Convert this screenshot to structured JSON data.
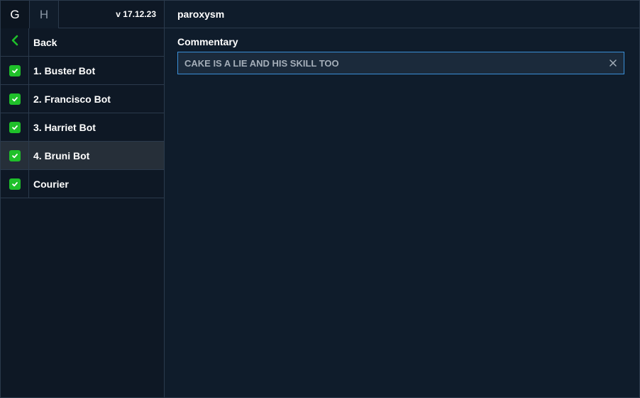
{
  "sidebar": {
    "tabs": [
      {
        "label": "G",
        "active": true
      },
      {
        "label": "H",
        "active": false
      }
    ],
    "version": "v 17.12.23",
    "back_label": "Back",
    "items": [
      {
        "label": "1. Buster Bot",
        "checked": true
      },
      {
        "label": "2. Francisco Bot",
        "checked": true
      },
      {
        "label": "3. Harriet Bot",
        "checked": true
      },
      {
        "label": "4. Bruni Bot",
        "checked": true,
        "selected": true
      },
      {
        "label": "Courier",
        "checked": true
      }
    ]
  },
  "header": {
    "title": "paroxysm"
  },
  "commentary": {
    "label": "Commentary",
    "value": "CAKE IS A LIE AND HIS SKILL TOO"
  },
  "colors": {
    "background": "#0f1c2b",
    "check": "#1fc02a",
    "focus_border": "#3a8fd8"
  }
}
